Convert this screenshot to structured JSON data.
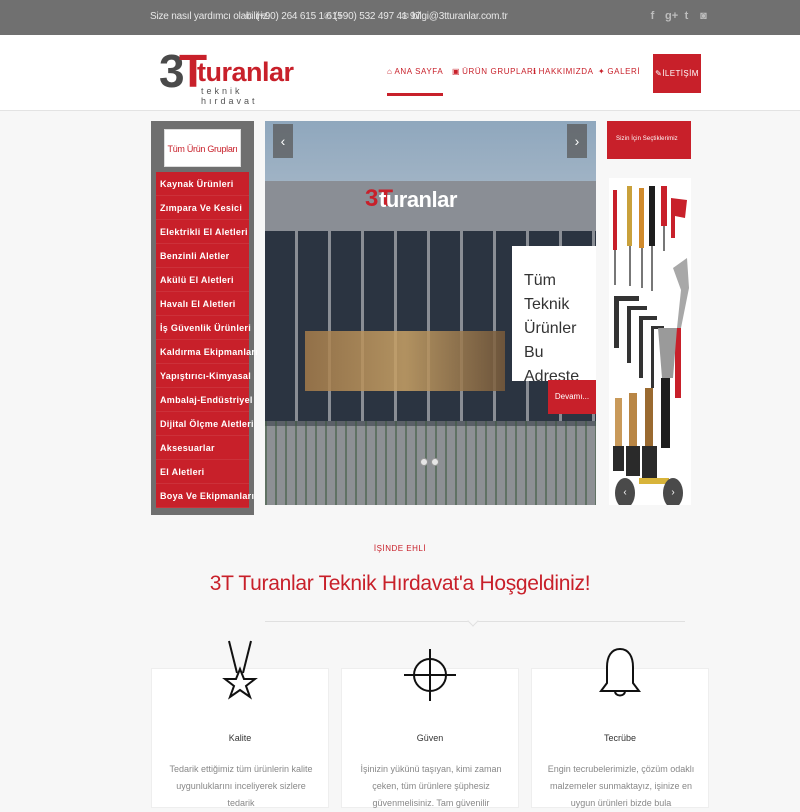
{
  "topbar": {
    "help_text": "Size nasıl yardımcı olabiliriz.",
    "phone1": "(+90) 264 615 1 615",
    "phone2": "(+90) 532 497 41 97",
    "email": "bilgi@3tturanlar.com.tr",
    "phone_icon": "phone-icon",
    "mail_icon": "mail-icon",
    "social": [
      "facebook-icon",
      "google-plus-icon",
      "twitter-icon",
      "instagram-icon"
    ]
  },
  "logo": {
    "mark_3": "3",
    "mark_t": "T",
    "name": "turanlar",
    "subtitle": "teknik hırdavat"
  },
  "nav": {
    "items": [
      {
        "label": "ANA SAYFA",
        "icon": "home-icon",
        "active": true
      },
      {
        "label": "ÜRÜN GRUPLARI",
        "icon": "box-icon"
      },
      {
        "label": "HAKKIMIZDA",
        "icon": "info-icon"
      },
      {
        "label": "GALERİ",
        "icon": "image-icon"
      }
    ],
    "cta_label": "İLETİŞİM",
    "cta_icon": "pencil-icon"
  },
  "sidebar": {
    "header": "Tüm Ürün Grupları",
    "items": [
      "Kaynak Ürünleri",
      "Zımpara Ve Kesici",
      "Elektrikli El Aletleri",
      "Benzinli Aletler",
      "Akülü El Aletleri",
      "Havalı El Aletleri",
      "İş Güvenlik Ürünleri",
      "Kaldırma Ekipmanları",
      "Yapıştırıcı-Kimyasal",
      "Ambalaj-Endüstriyel",
      "Dijital Ölçme Aletleri",
      "Aksesuarlar",
      "El Aletleri",
      "Boya Ve Ekipmanları"
    ]
  },
  "slider": {
    "sign_mark": "3T",
    "sign_text": "turanlar",
    "caption": "Tüm Teknik Ürünler Bu Adreste",
    "button": "Devamı...",
    "prev_icon": "chevron-left-icon",
    "next_icon": "chevron-right-icon",
    "prev_glyph": "‹",
    "next_glyph": "›"
  },
  "promo": {
    "header": "Sizin İçin Seçtiklerimiz",
    "prev_glyph": "‹",
    "next_glyph": "›"
  },
  "welcome": {
    "eyebrow": "İŞİNDE EHLİ",
    "title": "3T Turanlar Teknik Hırdavat'a Hoşgeldiniz!"
  },
  "features": [
    {
      "title": "Kalite",
      "icon": "medal-icon",
      "text": "Tedarik ettiğimiz tüm ürünlerin kalite uygunluklarını inceliyerek sizlere tedarik"
    },
    {
      "title": "Güven",
      "icon": "crosshair-icon",
      "text": "İşinizin yükünü taşıyan, kimi zaman çeken, tüm ürünlere şüphesiz güvenmelisiniz. Tam güvenilir"
    },
    {
      "title": "Tecrübe",
      "icon": "bell-icon",
      "text": "Engin tecrubelerimizle, çözüm odaklı malzemeler sunmaktayız, işinize en uygun ürünleri bizde bula"
    }
  ],
  "colors": {
    "accent": "#c8202a",
    "topbar": "#707070",
    "sidebar": "#6f6f6f"
  }
}
